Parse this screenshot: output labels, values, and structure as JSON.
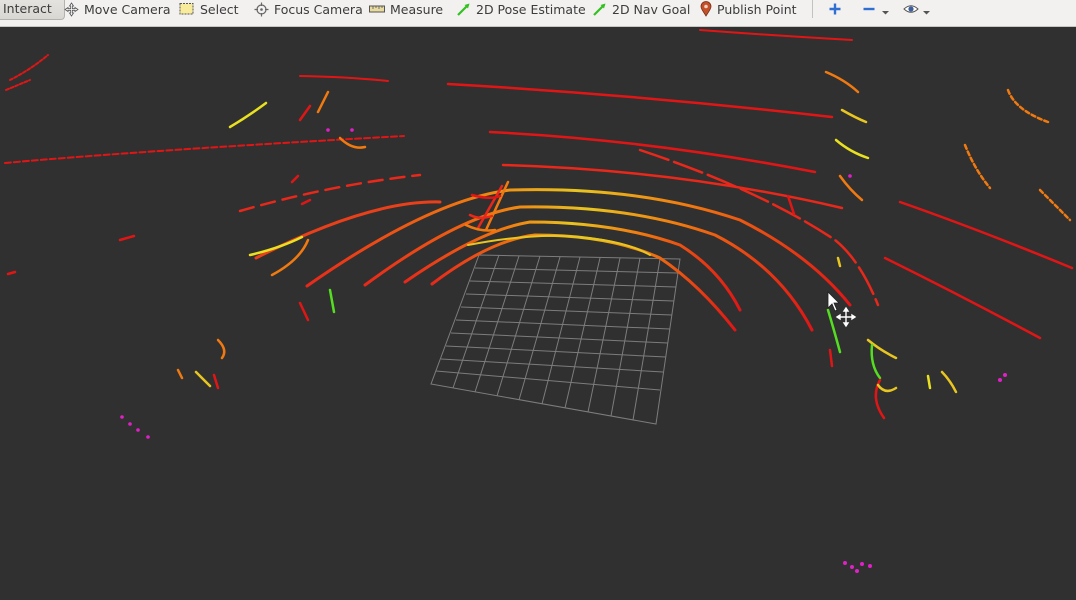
{
  "toolbar": {
    "interact": "Interact",
    "move_camera": "Move Camera",
    "select": "Select",
    "focus_camera": "Focus Camera",
    "measure": "Measure",
    "pose_estimate": "2D Pose Estimate",
    "nav_goal": "2D Nav Goal",
    "publish_point": "Publish Point"
  },
  "toolbar_icons": [
    "move-camera-icon",
    "select-icon",
    "focus-camera-icon",
    "measure-icon",
    "pose-estimate-arrow-icon",
    "nav-goal-arrow-icon",
    "map-pin-icon",
    "add-tool-icon",
    "remove-tool-icon",
    "view-eye-icon"
  ],
  "colors": {
    "viewport_background": "#303030",
    "grid": "#8a8a8a",
    "scan_red": "#e01616",
    "scan_orange": "#f07a10",
    "scan_yellow": "#e8e020",
    "scan_green": "#55dd22",
    "scan_magenta": "#e020c8"
  }
}
